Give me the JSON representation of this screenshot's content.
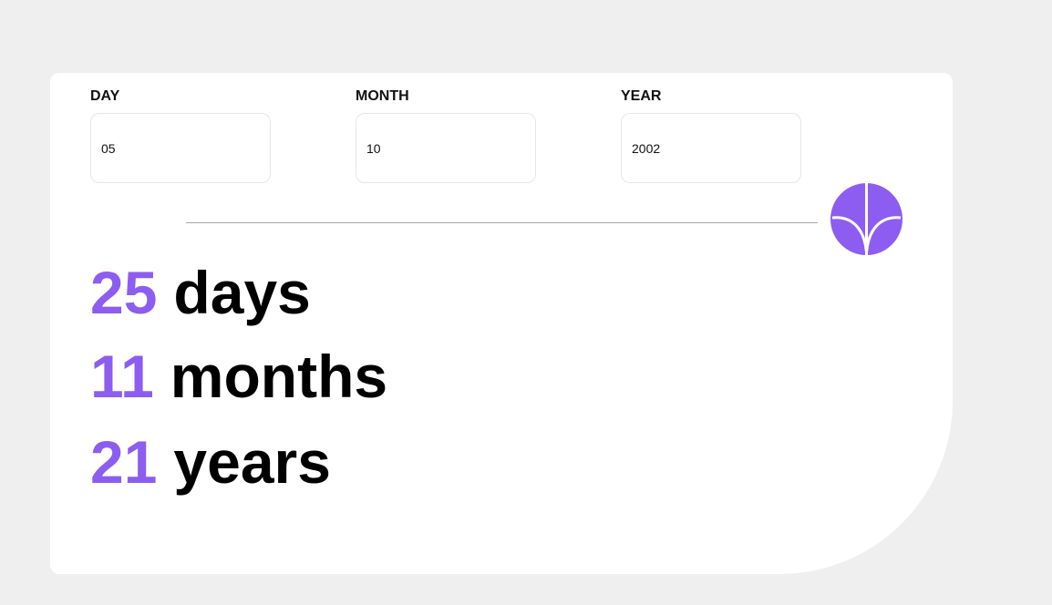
{
  "form": {
    "day": {
      "label": "DAY",
      "value": "05"
    },
    "month": {
      "label": "MONTH",
      "value": "10"
    },
    "year": {
      "label": "YEAR",
      "value": "2002"
    },
    "submit_icon": "arrow-down-icon"
  },
  "result": {
    "days": {
      "number": "25",
      "unit": "days"
    },
    "months": {
      "number": "11",
      "unit": "months"
    },
    "years": {
      "number": "21",
      "unit": "years"
    }
  },
  "colors": {
    "accent": "#8c5df0",
    "background": "#efefef",
    "card": "#ffffff",
    "divider": "#a9a9a9",
    "text": "#000000"
  }
}
